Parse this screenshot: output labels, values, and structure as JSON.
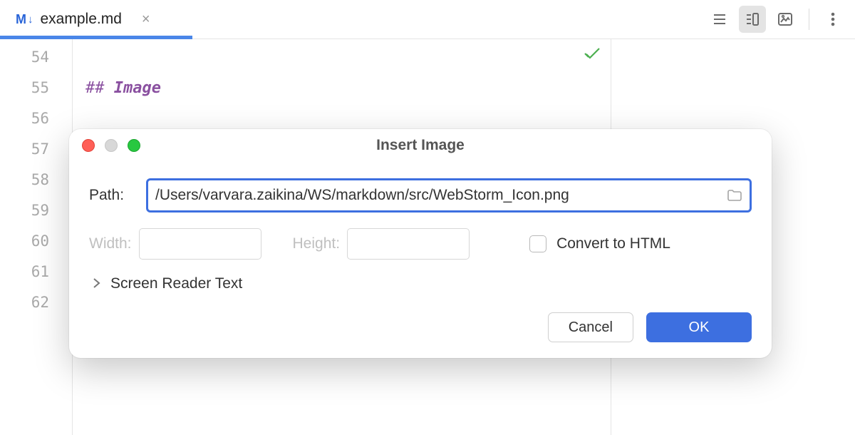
{
  "tab": {
    "icon_letter": "M",
    "icon_arrow": "↓",
    "filename": "example.md",
    "close_glyph": "×"
  },
  "toolbar_icons": {
    "view_source": "source",
    "view_split": "split",
    "view_preview": "preview",
    "more": "more"
  },
  "editor": {
    "line_numbers": [
      "54",
      "55",
      "56",
      "57",
      "58",
      "59",
      "60",
      "61",
      "62"
    ],
    "heading_hash": "##",
    "heading_text": "Image"
  },
  "dialog": {
    "title": "Insert Image",
    "path_label": "Path:",
    "path_value": "/Users/varvara.zaikina/WS/markdown/src/WebStorm_Icon.png",
    "width_label": "Width:",
    "width_value": "",
    "height_label": "Height:",
    "height_value": "",
    "convert_label": "Convert to HTML",
    "screenreader_label": "Screen Reader Text",
    "cancel_label": "Cancel",
    "ok_label": "OK"
  }
}
